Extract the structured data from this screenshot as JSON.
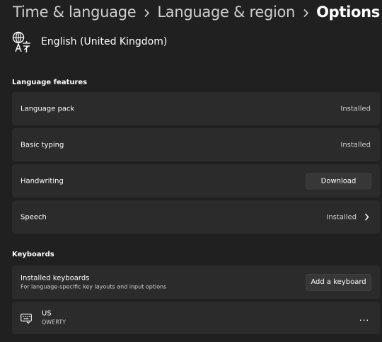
{
  "breadcrumb": {
    "items": [
      "Time & language",
      "Language & region"
    ],
    "current": "Options"
  },
  "language": {
    "name": "English (United Kingdom)",
    "icon": "language-icon"
  },
  "language_features": {
    "title": "Language features",
    "items": [
      {
        "label": "Language pack",
        "status": "Installed"
      },
      {
        "label": "Basic typing",
        "status": "Installed"
      },
      {
        "label": "Handwriting",
        "button": "Download"
      },
      {
        "label": "Speech",
        "status": "Installed",
        "icon": "chevron-right-icon"
      }
    ]
  },
  "keyboards": {
    "title": "Keyboards",
    "installed": {
      "label": "Installed keyboards",
      "description": "For language-specific key layouts and input options",
      "button": "Add a keyboard"
    },
    "list": [
      {
        "name": "US",
        "layout": "QWERTY",
        "icon": "keyboard-icon",
        "more": "..."
      }
    ]
  },
  "colors": {
    "background": "#202020",
    "card": "#2b2b2b",
    "button": "#373737"
  }
}
